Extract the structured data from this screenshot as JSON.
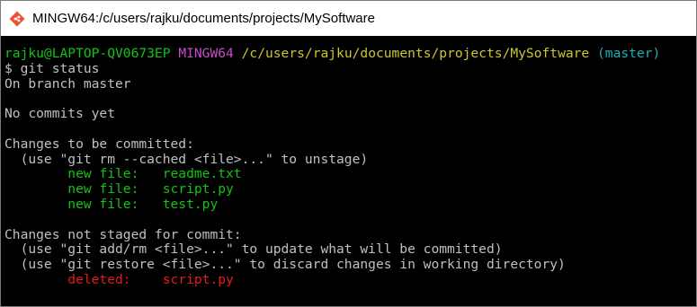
{
  "window": {
    "title": "MINGW64:/c/users/rajku/documents/projects/MySoftware",
    "icon": "git-bash-icon",
    "colors": {
      "background": "#000000",
      "prompt_user": "#13c313",
      "prompt_shell": "#c84cc8",
      "prompt_path": "#c8c832",
      "prompt_branch": "#1ab0b8",
      "staged": "#13c313",
      "unstaged": "#e31b1b"
    }
  },
  "prompt": {
    "user": "rajku@LAPTOP-QV0673EP",
    "shell": "MINGW64",
    "path": "/c/users/rajku/documents/projects/MySoftware",
    "branch": "(master)"
  },
  "command": "$ git status",
  "output": {
    "on_branch": "On branch master",
    "no_commits": "No commits yet",
    "to_be_committed_header": "Changes to be committed:",
    "unstage_hint": "  (use \"git rm --cached <file>...\" to unstage)",
    "staged_files": [
      "        new file:   readme.txt",
      "        new file:   script.py",
      "        new file:   test.py"
    ],
    "not_staged_header": "Changes not staged for commit:",
    "not_staged_hints": [
      "  (use \"git add/rm <file>...\" to update what will be committed)",
      "  (use \"git restore <file>...\" to discard changes in working directory)"
    ],
    "unstaged_files": [
      "        deleted:    script.py"
    ]
  }
}
